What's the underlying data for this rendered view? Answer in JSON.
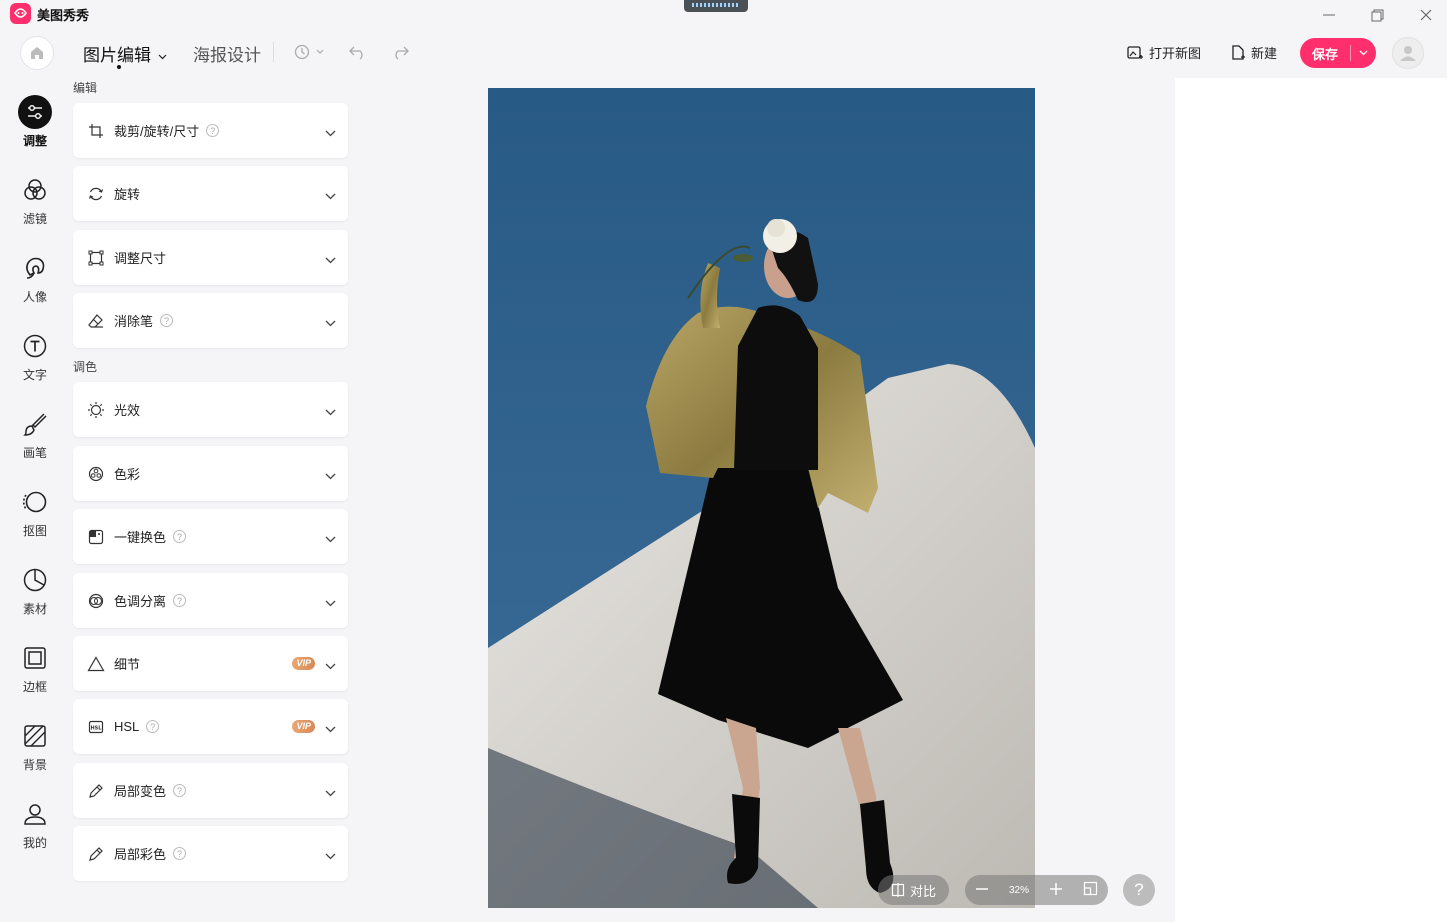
{
  "app": {
    "name": "美图秀秀"
  },
  "header": {
    "tabs": [
      {
        "label": "图片编辑",
        "active": true
      },
      {
        "label": "海报设计",
        "active": false
      }
    ],
    "actions": {
      "open_new": "打开新图",
      "new": "新建",
      "save": "保存"
    }
  },
  "rail": {
    "items": [
      {
        "label": "调整",
        "icon": "sliders-icon",
        "active": true
      },
      {
        "label": "滤镜",
        "icon": "filter-icon"
      },
      {
        "label": "人像",
        "icon": "portrait-icon"
      },
      {
        "label": "文字",
        "icon": "text-icon"
      },
      {
        "label": "画笔",
        "icon": "brush-icon"
      },
      {
        "label": "抠图",
        "icon": "cutout-icon"
      },
      {
        "label": "素材",
        "icon": "sticker-icon"
      },
      {
        "label": "边框",
        "icon": "frame-icon"
      },
      {
        "label": "背景",
        "icon": "background-icon"
      },
      {
        "label": "我的",
        "icon": "user-icon"
      }
    ]
  },
  "panel": {
    "sections": {
      "edit": "编辑",
      "color": "调色"
    },
    "edit_items": [
      {
        "label": "裁剪/旋转/尺寸",
        "icon": "crop-icon",
        "help": true
      },
      {
        "label": "旋转",
        "icon": "rotate-icon"
      },
      {
        "label": "调整尺寸",
        "icon": "resize-icon"
      },
      {
        "label": "消除笔",
        "icon": "eraser-icon",
        "help": true
      }
    ],
    "color_items": [
      {
        "label": "光效",
        "icon": "light-icon"
      },
      {
        "label": "色彩",
        "icon": "palette-icon"
      },
      {
        "label": "一键换色",
        "icon": "color-swap-icon",
        "help": true
      },
      {
        "label": "色调分离",
        "icon": "split-tone-icon",
        "help": true
      },
      {
        "label": "细节",
        "icon": "detail-icon",
        "vip": "VIP"
      },
      {
        "label": "HSL",
        "icon": "hsl-icon",
        "help": true,
        "vip": "VIP"
      },
      {
        "label": "局部变色",
        "icon": "local-color-icon",
        "help": true
      },
      {
        "label": "局部彩色",
        "icon": "local-paint-icon",
        "help": true
      }
    ]
  },
  "canvas": {
    "compare": "对比",
    "zoom": "32%",
    "help": "?"
  },
  "colors": {
    "accent": "#ff2f6d",
    "sky": "#2b5a87"
  }
}
